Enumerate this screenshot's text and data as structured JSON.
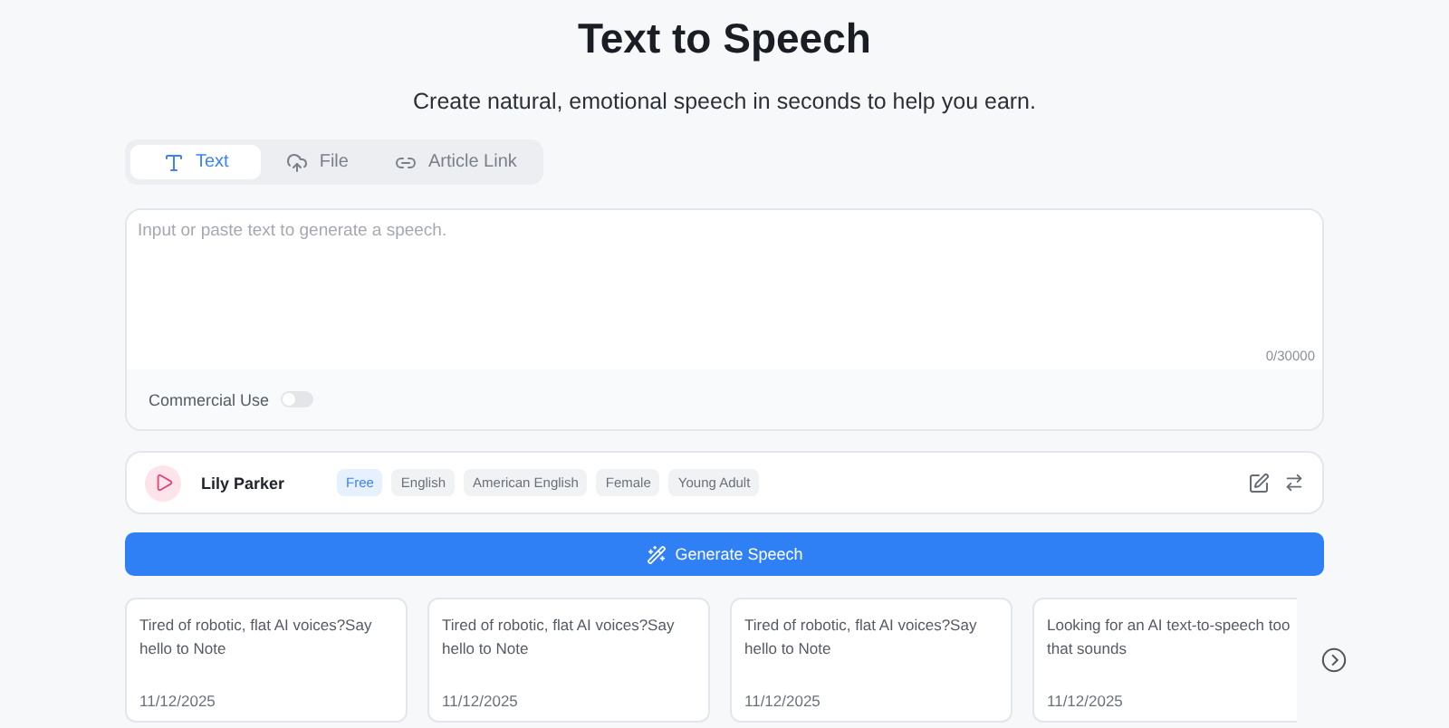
{
  "title": "Text to Speech",
  "subtitle": "Create natural, emotional speech in seconds to help you earn.",
  "tabs": [
    {
      "label": "Text",
      "kind": "text",
      "selected": true
    },
    {
      "label": "File",
      "kind": "file",
      "selected": false
    },
    {
      "label": "Article Link",
      "kind": "link",
      "selected": false
    }
  ],
  "editor": {
    "placeholder": "Input or paste text to generate a speech.",
    "counter": "0/30000",
    "commercial_use": {
      "label": "Commercial Use",
      "on": false
    }
  },
  "voice": {
    "name": "Lily Parker",
    "tags": [
      {
        "label": "Free",
        "kind": "plan"
      },
      {
        "label": "English",
        "kind": "attr"
      },
      {
        "label": "American English",
        "kind": "attr"
      },
      {
        "label": "Female",
        "kind": "attr"
      },
      {
        "label": "Young Adult",
        "kind": "attr"
      }
    ]
  },
  "generate_button": "Generate Speech",
  "cards": [
    {
      "lines": [
        "Tired of robotic, flat AI voices?Say",
        "hello to Note"
      ],
      "date": "11/12/2025"
    },
    {
      "lines": [
        "Tired of robotic, flat AI voices?Say",
        "hello to Note"
      ],
      "date": "11/12/2025"
    },
    {
      "lines": [
        "Tired of robotic, flat AI voices?Say",
        "hello to Note"
      ],
      "date": "11/12/2025"
    },
    {
      "lines": [
        "Looking for an AI text-to-speech too",
        "that sounds"
      ],
      "date": "11/12/2025"
    }
  ]
}
